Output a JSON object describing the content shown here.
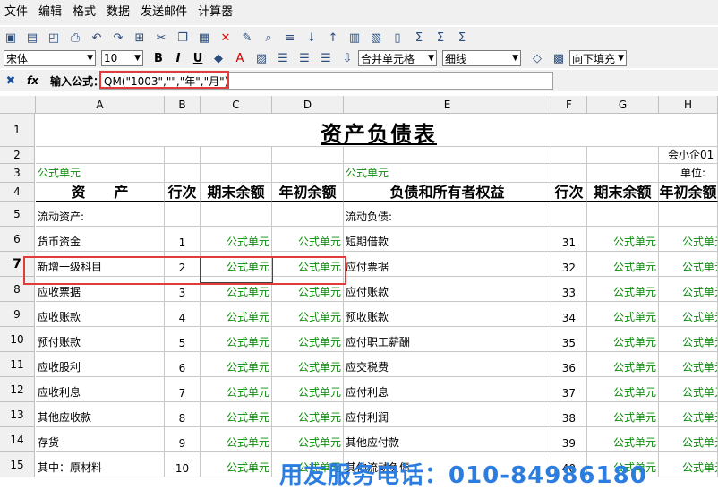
{
  "menu": [
    "文件",
    "编辑",
    "格式",
    "数据",
    "发送邮件",
    "计算器"
  ],
  "toolbar2": {
    "font": "宋体",
    "size": "10",
    "bold": "B",
    "italic": "I",
    "underline": "U",
    "merge": "合并单元格",
    "border": "细线",
    "fill": "向下填充"
  },
  "formula": {
    "label": "输入公式：",
    "fx": "fx",
    "value": "QM(\"1003\",\"\",\"年\",\"月\")"
  },
  "columns": [
    "A",
    "B",
    "C",
    "D",
    "E",
    "F",
    "G",
    "H"
  ],
  "rows": [
    "1",
    "2",
    "3",
    "4",
    "5",
    "6",
    "7",
    "8",
    "9",
    "10",
    "11",
    "12",
    "13",
    "14",
    "15"
  ],
  "sheet": {
    "title": "资产负债表",
    "company": "会小企01",
    "unit": "单位:",
    "formula_cell": "公式单元",
    "headers": {
      "asset": "资　　产",
      "line": "行次",
      "end": "期末余额",
      "begin": "年初余额",
      "liab": "负债和所有者权益",
      "line2": "行次",
      "end2": "期末余额",
      "begin2": "年初余额"
    },
    "current_assets": "流动资产:",
    "current_liab": "流动负债:",
    "asset_rows": [
      {
        "name": "货币资金",
        "line": "1"
      },
      {
        "name": "新增一级科目",
        "line": "2"
      },
      {
        "name": "应收票据",
        "line": "3"
      },
      {
        "name": "应收账款",
        "line": "4"
      },
      {
        "name": "预付账款",
        "line": "5"
      },
      {
        "name": "应收股利",
        "line": "6"
      },
      {
        "name": "应收利息",
        "line": "7"
      },
      {
        "name": "其他应收款",
        "line": "8"
      },
      {
        "name": "存货",
        "line": "9"
      },
      {
        "name": "其中：原材料",
        "line": "10"
      }
    ],
    "liab_rows": [
      {
        "name": "短期借款",
        "line": "31"
      },
      {
        "name": "应付票据",
        "line": "32"
      },
      {
        "name": "应付账款",
        "line": "33"
      },
      {
        "name": "预收账款",
        "line": "34"
      },
      {
        "name": "应付职工薪酬",
        "line": "35"
      },
      {
        "name": "应交税费",
        "line": "36"
      },
      {
        "name": "应付利息",
        "line": "37"
      },
      {
        "name": "应付利润",
        "line": "38"
      },
      {
        "name": "其他应付款",
        "line": "39"
      },
      {
        "name": "其他流动负债",
        "line": "40"
      }
    ]
  },
  "watermark": "用友服务电话：010-84986180"
}
